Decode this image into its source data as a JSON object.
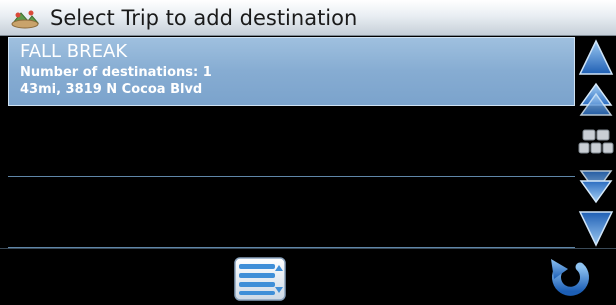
{
  "titlebar": {
    "icon": "trip-icon",
    "title": "Select Trip to add destination"
  },
  "trips": [
    {
      "name": "FALL BREAK",
      "destinations_line": "Number of destinations: 1",
      "detail_line": "43mi, 3819 N Cocoa Blvd",
      "selected": true
    }
  ],
  "scroll": {
    "buttons": [
      "page-up-icon",
      "scroll-up-icon",
      "keyboard-icon",
      "scroll-down-icon",
      "page-down-icon"
    ]
  },
  "bottombar": {
    "list_button_icon": "list-icon",
    "back_button_icon": "back-arrow-icon"
  },
  "colors": {
    "selected_row": "#86acd2",
    "accent_blue": "#2f74c8",
    "background": "#000000"
  }
}
